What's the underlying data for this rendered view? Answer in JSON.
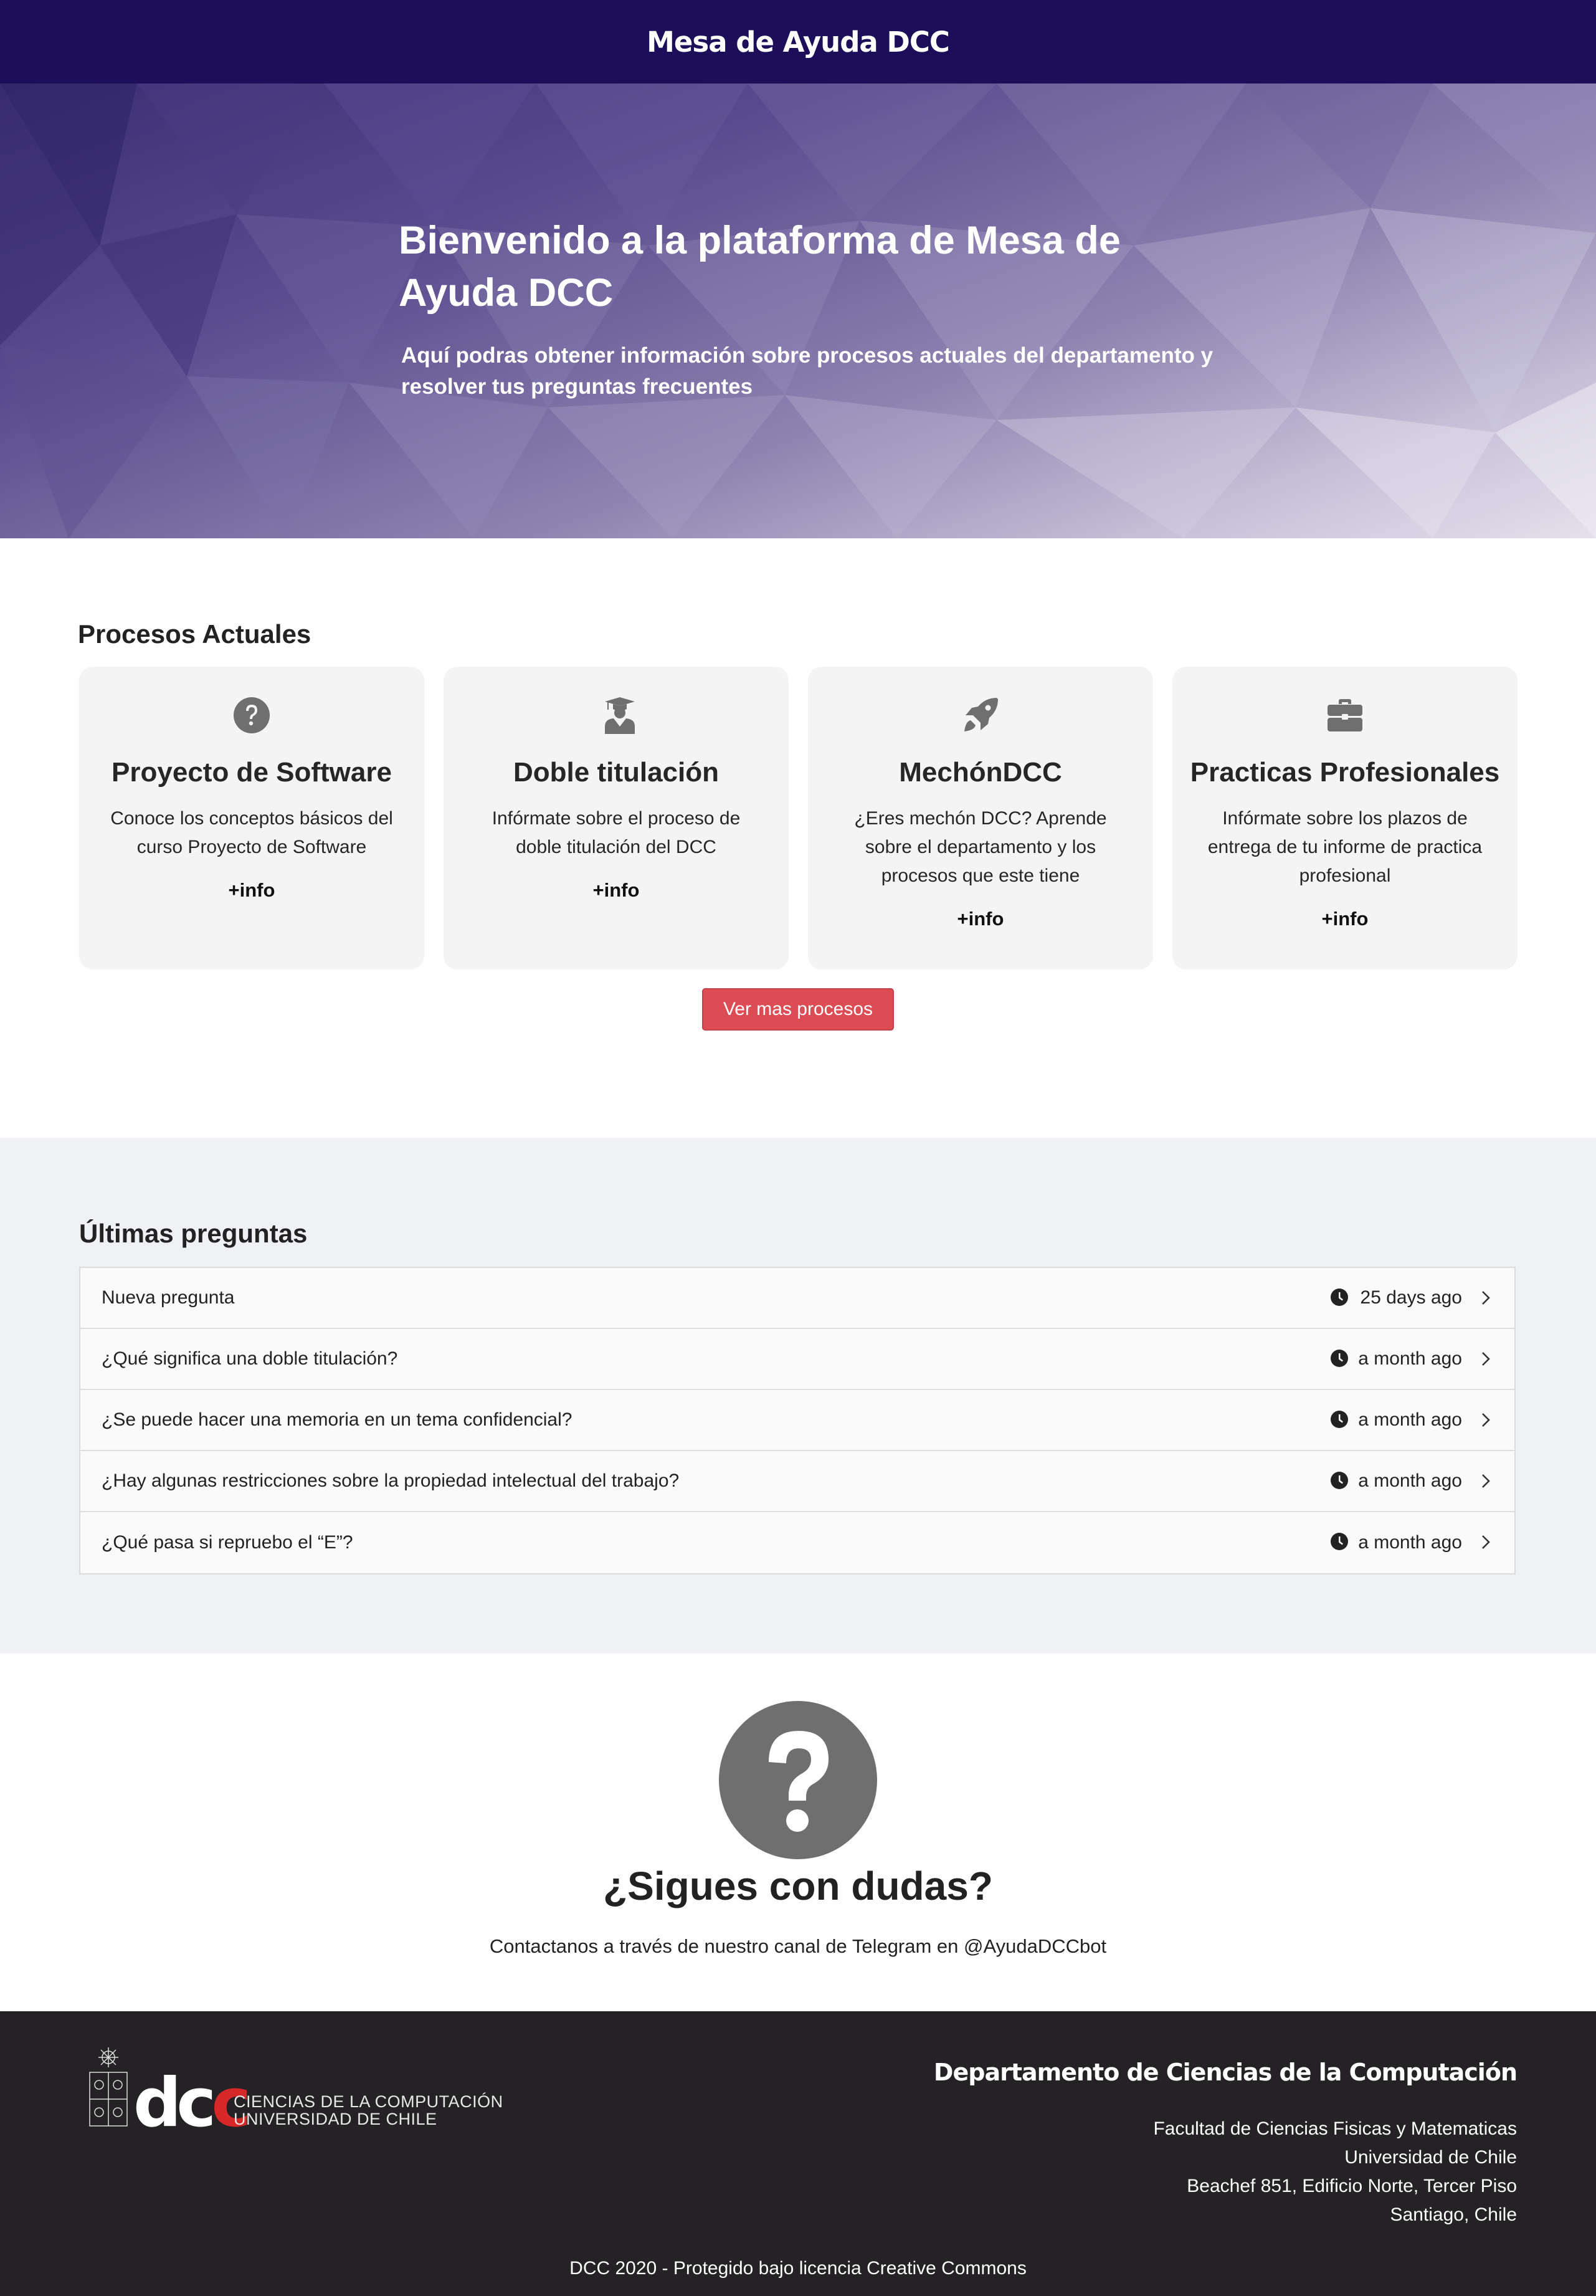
{
  "navbar": {
    "brand": "Mesa de Ayuda DCC"
  },
  "hero": {
    "title": "Bienvenido a la plataforma de Mesa de Ayuda DCC",
    "subtitle": "Aquí podras obtener información sobre procesos actuales del departamento y resolver tus preguntas frecuentes"
  },
  "procesos": {
    "title": "Procesos Actuales",
    "cards": [
      {
        "icon": "question-circle-icon",
        "title": "Proyecto de Software",
        "desc": "Conoce los conceptos básicos del curso Proyecto de Software",
        "more": "+info"
      },
      {
        "icon": "graduate-icon",
        "title": "Doble titulación",
        "desc": "Infórmate sobre el proceso de doble titulación del DCC",
        "more": "+info"
      },
      {
        "icon": "rocket-icon",
        "title": "MechónDCC",
        "desc": "¿Eres mechón DCC? Aprende sobre el departamento y los procesos que este tiene",
        "more": "+info"
      },
      {
        "icon": "briefcase-icon",
        "title": "Practicas Profesionales",
        "desc": "Infórmate sobre los plazos de entrega de tu informe de practica profesional",
        "more": "+info"
      }
    ],
    "button": "Ver mas procesos"
  },
  "preguntas": {
    "title": "Últimas preguntas",
    "items": [
      {
        "text": "Nueva pregunta",
        "time": "25 days ago"
      },
      {
        "text": "¿Qué significa una doble titulación?",
        "time": "a month ago"
      },
      {
        "text": "¿Se puede hacer una memoria en un tema confidencial?",
        "time": "a month ago"
      },
      {
        "text": "¿Hay algunas restricciones sobre la propiedad intelectual del trabajo?",
        "time": "a month ago"
      },
      {
        "text": "¿Qué pasa si repruebo el “E”?",
        "time": "a month ago"
      }
    ]
  },
  "dudas": {
    "title": "¿Sigues con dudas?",
    "text": "Contactanos a través de nuestro canal de Telegram en @AyudaDCCbot"
  },
  "footer": {
    "logo_line1": "CIENCIAS DE LA COMPUTACIÓN",
    "logo_line2": "UNIVERSIDAD DE CHILE",
    "logo_mark": "dcc",
    "dept": "Departamento de Ciencias de la Computación",
    "address": [
      "Facultad de Ciencias Fisicas y Matematicas",
      "Universidad de Chile",
      "Beachef 851, Edificio Norte, Tercer Piso",
      "Santiago, Chile"
    ],
    "copyright": "DCC 2020 - Protegido bajo licencia Creative Commons"
  },
  "colors": {
    "navbar": "#1c0e58",
    "button": "#dc4c54",
    "footer": "#242224",
    "section_alt": "#f0f1f5"
  }
}
